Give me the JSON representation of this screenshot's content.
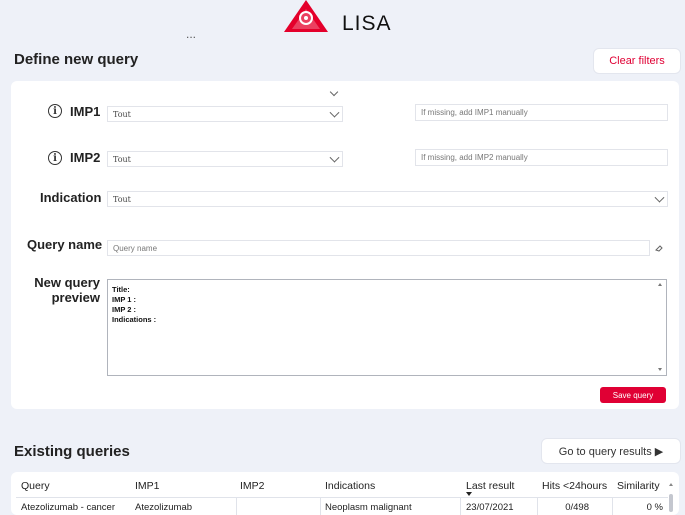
{
  "app": {
    "name": "LISA"
  },
  "header": {
    "more_label": "..."
  },
  "define": {
    "title": "Define new query",
    "clear_filters": "Clear filters",
    "imp1": {
      "label": "IMP1",
      "select_value": "Tout",
      "manual_placeholder": "If missing, add IMP1 manually"
    },
    "imp2": {
      "label": "IMP2",
      "select_value": "Tout",
      "manual_placeholder": "If missing, add IMP2 manually"
    },
    "indication": {
      "label": "Indication",
      "select_value": "Tout"
    },
    "query_name": {
      "label": "Query name",
      "placeholder": "Query name"
    },
    "preview": {
      "label_line1": "New query",
      "label_line2": "preview",
      "text": "Title:\nIMP 1 :\nIMP 2 :\nIndications :"
    },
    "save_query": "Save query"
  },
  "existing": {
    "title": "Existing queries",
    "go_to_results": "Go to query results ▶",
    "columns": [
      "Query",
      "IMP1",
      "IMP2",
      "Indications",
      "Last result",
      "Hits <24hours",
      "Similarity"
    ],
    "rows": [
      [
        "Atezolizumab - cancer",
        "Atezolizumab",
        "",
        "Neoplasm malignant",
        "23/07/2021",
        "0/498",
        "0 %"
      ]
    ]
  },
  "colors": {
    "accent": "#e00034",
    "background": "#eef1f8"
  }
}
